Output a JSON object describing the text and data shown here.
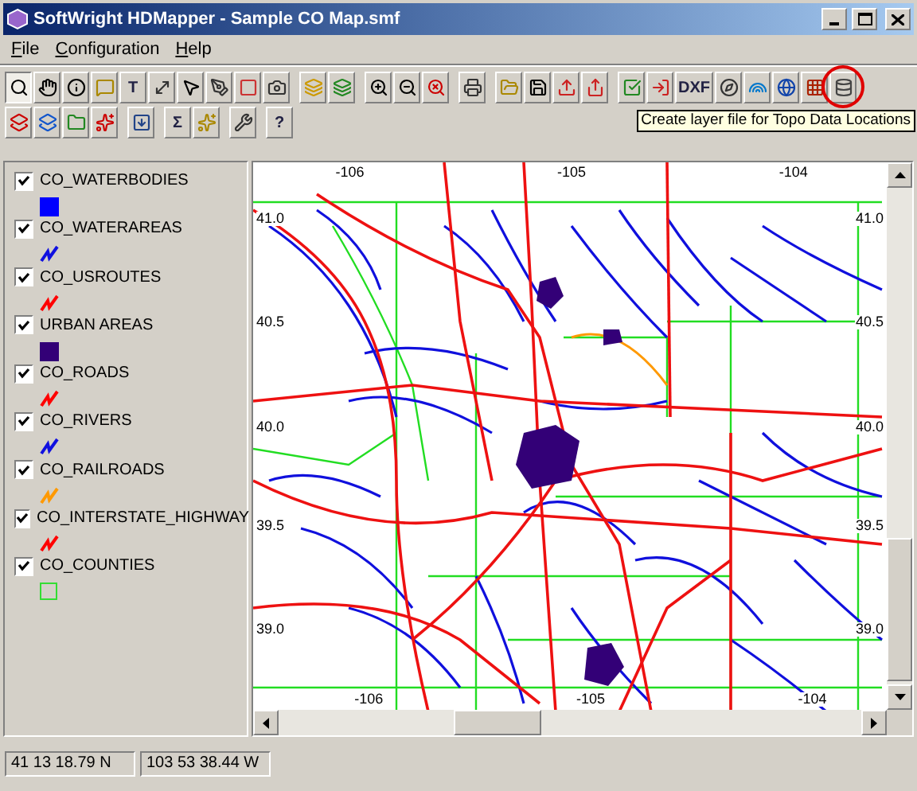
{
  "window": {
    "title": "SoftWright HDMapper - Sample CO Map.smf"
  },
  "menu": [
    {
      "label": "File"
    },
    {
      "label": "Configuration"
    },
    {
      "label": "Help"
    }
  ],
  "toolbar_rows": [
    [
      {
        "kind": "icon",
        "pressed": true
      },
      {
        "kind": "icon",
        "pressed": false
      },
      {
        "kind": "icon",
        "pressed": false
      },
      {
        "kind": "icon",
        "pressed": false
      },
      {
        "kind": "text",
        "label": "T",
        "pressed": false
      },
      {
        "kind": "icon",
        "pressed": false
      },
      {
        "kind": "icon",
        "pressed": false
      },
      {
        "kind": "icon",
        "pressed": false
      },
      {
        "kind": "icon",
        "pressed": false
      },
      {
        "kind": "icon",
        "pressed": false
      },
      {
        "kind": "gap"
      },
      {
        "kind": "icon",
        "pressed": false
      },
      {
        "kind": "icon",
        "pressed": false
      },
      {
        "kind": "gap"
      },
      {
        "kind": "icon",
        "pressed": false
      },
      {
        "kind": "icon",
        "pressed": false
      },
      {
        "kind": "icon",
        "pressed": false
      },
      {
        "kind": "gap"
      },
      {
        "kind": "icon",
        "pressed": false
      },
      {
        "kind": "gap"
      },
      {
        "kind": "icon",
        "pressed": false
      },
      {
        "kind": "icon",
        "pressed": false
      },
      {
        "kind": "icon",
        "pressed": false
      },
      {
        "kind": "icon",
        "pressed": false
      },
      {
        "kind": "gap"
      },
      {
        "kind": "icon",
        "pressed": false
      },
      {
        "kind": "icon",
        "pressed": false
      },
      {
        "kind": "text",
        "label": "DXF",
        "pressed": false
      },
      {
        "kind": "icon",
        "pressed": false
      },
      {
        "kind": "icon",
        "pressed": false
      },
      {
        "kind": "icon",
        "pressed": false
      },
      {
        "kind": "icon",
        "pressed": false
      },
      {
        "kind": "icon",
        "pressed": false,
        "circled": true
      }
    ],
    [
      {
        "kind": "icon",
        "pressed": false
      },
      {
        "kind": "icon",
        "pressed": false
      },
      {
        "kind": "icon",
        "pressed": false
      },
      {
        "kind": "icon",
        "pressed": false
      },
      {
        "kind": "gap"
      },
      {
        "kind": "icon",
        "pressed": false
      },
      {
        "kind": "gap"
      },
      {
        "kind": "text",
        "label": "Σ",
        "pressed": false
      },
      {
        "kind": "icon",
        "pressed": false
      },
      {
        "kind": "gap"
      },
      {
        "kind": "icon",
        "pressed": false
      },
      {
        "kind": "gap"
      },
      {
        "kind": "text",
        "label": "?",
        "pressed": false
      }
    ]
  ],
  "tooltip": "Create layer file for Topo Data Locations",
  "layers": [
    {
      "name": "CO_WATERBODIES",
      "checked": true,
      "kind": "fill",
      "color": "#0000ff"
    },
    {
      "name": "CO_WATERAREAS",
      "checked": true,
      "kind": "line",
      "color": "#1010e0"
    },
    {
      "name": "CO_USROUTES",
      "checked": true,
      "kind": "line",
      "color": "#ff0000"
    },
    {
      "name": "URBAN AREAS",
      "checked": true,
      "kind": "fill",
      "color": "#330077"
    },
    {
      "name": "CO_ROADS",
      "checked": true,
      "kind": "line",
      "color": "#ff0000"
    },
    {
      "name": "CO_RIVERS",
      "checked": true,
      "kind": "line",
      "color": "#1010e0"
    },
    {
      "name": "CO_RAILROADS",
      "checked": true,
      "kind": "line",
      "color": "#ff9900"
    },
    {
      "name": "CO_INTERSTATE_HIGHWAY",
      "checked": true,
      "kind": "line",
      "color": "#ff0000"
    },
    {
      "name": "CO_COUNTIES",
      "checked": true,
      "kind": "outline",
      "color": "#33dd33"
    }
  ],
  "map": {
    "top_labels": [
      "-106",
      "-105",
      "-104"
    ],
    "left_labels": [
      "41.0",
      "40.5",
      "40.0",
      "39.5",
      "39.0"
    ],
    "right_labels": [
      "41.0",
      "40.5",
      "40.0",
      "39.5",
      "39.0"
    ],
    "bottom_labels": [
      "-106",
      "-105",
      "-104"
    ]
  },
  "status_bar": [
    "41 13 18.79 N",
    "103 53 38.44 W"
  ]
}
